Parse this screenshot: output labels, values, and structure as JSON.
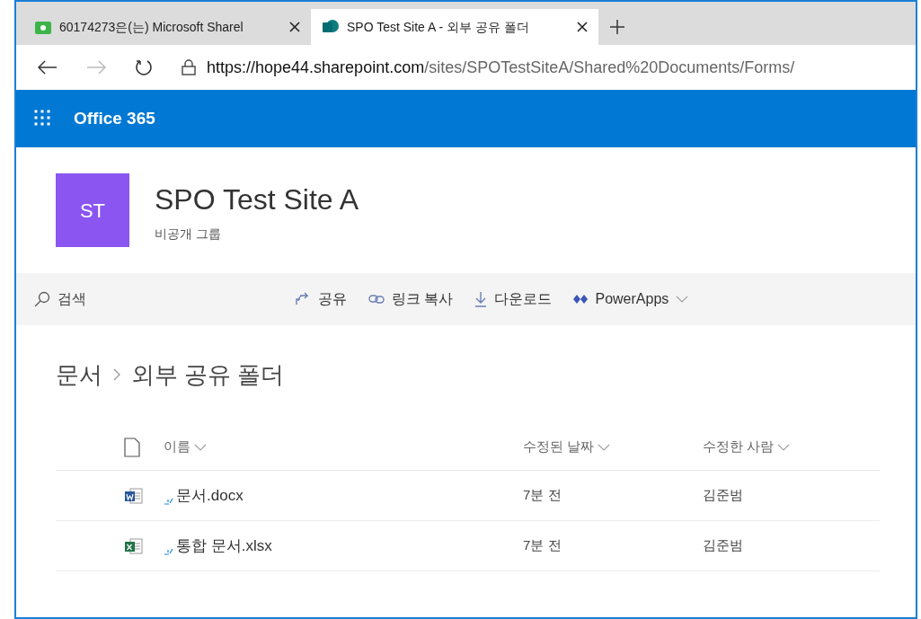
{
  "tabs": [
    {
      "title": "60174273은(는) Microsoft Sharel",
      "kind": "generic",
      "selected": false
    },
    {
      "title": "SPO Test Site A - 외부 공유 폴더",
      "kind": "sharepoint",
      "selected": true
    }
  ],
  "address": {
    "host": "https://hope44.sharepoint.com",
    "path": "/sites/SPOTestSiteA/Shared%20Documents/Forms/"
  },
  "app_bar": {
    "title": "Office 365"
  },
  "site": {
    "logo": "ST",
    "title": "SPO Test Site A",
    "subtitle": "비공개 그룹"
  },
  "command_bar": {
    "search": "검색",
    "commands": [
      {
        "label": "공유",
        "kind": "share"
      },
      {
        "label": "링크 복사",
        "kind": "link"
      },
      {
        "label": "다운로드",
        "kind": "download"
      },
      {
        "label": "PowerApps",
        "kind": "powerapps"
      }
    ]
  },
  "breadcrumb": [
    "문서",
    "외부 공유 폴더"
  ],
  "table": {
    "columns": [
      "이름",
      "수정된 날짜",
      "수정한 사람"
    ],
    "rows": [
      {
        "name": "문서.docx",
        "kind": "word",
        "modified": "7분 전",
        "modified_by": "김준범"
      },
      {
        "name": "통합 문서.xlsx",
        "kind": "excel",
        "modified": "7분 전",
        "modified_by": "김준범"
      }
    ]
  }
}
